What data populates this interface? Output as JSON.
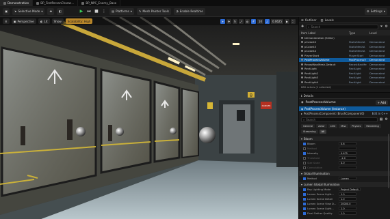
{
  "tabs": [
    {
      "label": "Demonstration",
      "active": true
    },
    {
      "label": "BP_FirstPersonCharac..."
    },
    {
      "label": "BP_NPC_Enemy_Base"
    }
  ],
  "toolbar": {
    "mode_label": "Selective Mode",
    "platforms_label": "Platforms",
    "tools_label": "Mesh Painter Tools",
    "realtime_label": "Enable Realtime",
    "settings_label": "Settings"
  },
  "viewport": {
    "perspective_label": "Perspective",
    "lit_label": "Lit",
    "show_label": "Show",
    "scalability_label": "Scalability: High",
    "snap_value": "0.0625",
    "grid_value": "10"
  },
  "scene": {
    "door_label": "B",
    "sign_label": "DANGER"
  },
  "outliner": {
    "tab_outliner": "Outliner",
    "tab_levels": "Levels",
    "search_placeholder": "Search",
    "col_name": "Item Label",
    "col_type": "Type",
    "col_level": "Level",
    "rows": [
      {
        "name": "Demonstration (Editor)",
        "type": "",
        "level": ""
      },
      {
        "name": "pCube40",
        "type": "StaticMeshA",
        "level": "Demonstrat"
      },
      {
        "name": "pCube43",
        "type": "StaticMeshA",
        "level": "Demonstrat"
      },
      {
        "name": "pCube44",
        "type": "StaticMeshA",
        "level": "Demonstrat"
      },
      {
        "name": "PlayerStart",
        "type": "PlayerStart",
        "level": "Demonstrat"
      },
      {
        "name": "PostProcessVolume",
        "type": "PostProcessV",
        "level": "Demonstrat",
        "selected": true
      },
      {
        "name": "RecastNavMesh-Default",
        "type": "RecastNavMe",
        "level": "Demonstrat"
      },
      {
        "name": "RectLight",
        "type": "RectLight",
        "level": "Demonstrat"
      },
      {
        "name": "RectLight2",
        "type": "RectLight",
        "level": "Demonstrat"
      },
      {
        "name": "RectLight3",
        "type": "RectLight",
        "level": "Demonstrat"
      },
      {
        "name": "RectLight4",
        "type": "RectLight",
        "level": "Demonstrat"
      }
    ],
    "status": "880 actors (1 selected)"
  },
  "details": {
    "tab_label": "Details",
    "actor_name": "PostProcessVolume",
    "add_label": "+ Add",
    "instance_label": "PostProcessVolume (Instance)",
    "component_label": "PostProcessComponent (BrushComponent0)",
    "component_hint": "Edit in C++",
    "categories": [
      "General",
      "Actor",
      "LOD",
      "Misc",
      "Physics",
      "Rendering",
      "Streaming",
      "All"
    ],
    "section_bloom": "Bloom",
    "section_global": "Global Illumination",
    "section_lumen": "Lumen Global Illumination",
    "props_top": [
      {
        "label": "Bloom",
        "value": "0.6",
        "on": true
      },
      {
        "label": "Method",
        "value": "",
        "on": false
      },
      {
        "label": "Intensity",
        "value": "0.675",
        "on": true
      },
      {
        "label": "Threshold",
        "value": "-1.0",
        "on": false
      },
      {
        "label": "Size Scale",
        "value": "4.0",
        "on": false
      },
      {
        "label": "Convolution",
        "value": "",
        "on": false
      }
    ],
    "method_label": "Method",
    "method_value": "Lumen",
    "props_lumen": [
      {
        "label": "Ray Lighting Mode",
        "value": "Project Default"
      },
      {
        "label": "Lumen Scene Light...",
        "value": "1.0"
      },
      {
        "label": "Lumen Scene Detail",
        "value": "1.0"
      },
      {
        "label": "Lumen Scene View D...",
        "value": "20000.0"
      },
      {
        "label": "Lumen Scene Light...",
        "value": "1.0"
      },
      {
        "label": "Final Gather Quality",
        "value": "1.0"
      }
    ]
  },
  "colors": {
    "selection": "#0e5a9c",
    "accent": "#2d6bd6",
    "warning": "#b8862a"
  }
}
